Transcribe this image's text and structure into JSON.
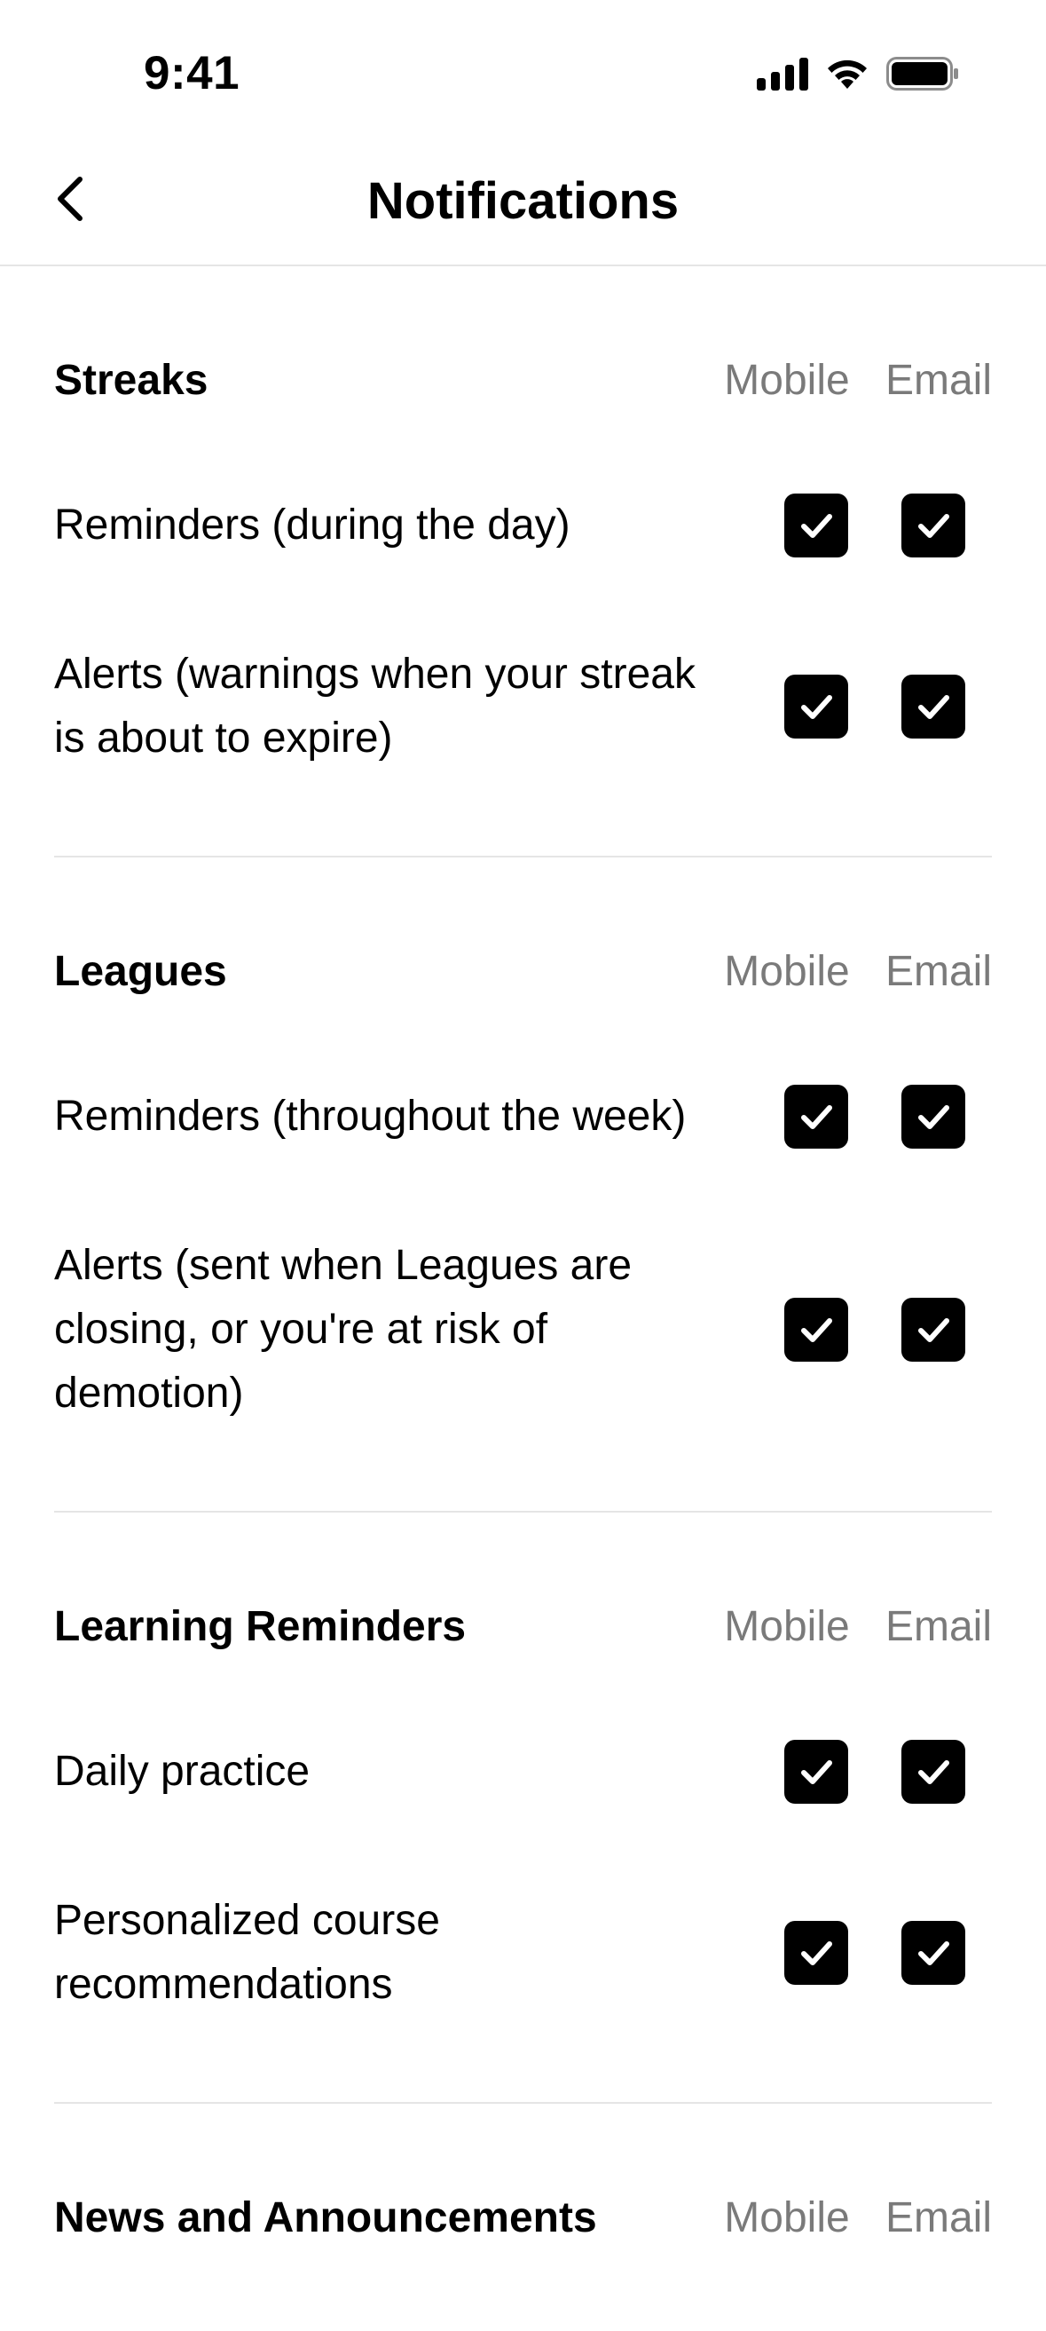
{
  "status_bar": {
    "time": "9:41",
    "icons": [
      "cellular-signal-icon",
      "wifi-icon",
      "battery-icon"
    ]
  },
  "nav": {
    "back_icon": "chevron-left-icon",
    "title": "Notifications"
  },
  "columns": {
    "mobile": "Mobile",
    "email": "Email"
  },
  "sections": [
    {
      "title": "Streaks",
      "rows": [
        {
          "label": "Reminders (during the day)",
          "mobile": true,
          "email": true
        },
        {
          "label": "Alerts (warnings when your streak is about to expire)",
          "mobile": true,
          "email": true
        }
      ]
    },
    {
      "title": "Leagues",
      "rows": [
        {
          "label": "Reminders (throughout the week)",
          "mobile": true,
          "email": true
        },
        {
          "label": "Alerts (sent when Leagues are closing, or you're at risk of demotion)",
          "mobile": true,
          "email": true
        }
      ]
    },
    {
      "title": "Learning Reminders",
      "rows": [
        {
          "label": "Daily practice",
          "mobile": true,
          "email": true
        },
        {
          "label": "Personalized course recommendations",
          "mobile": true,
          "email": true
        }
      ]
    },
    {
      "title": "News and Announcements",
      "rows": []
    }
  ],
  "colors": {
    "text": "#000000",
    "muted": "#7a7a7a",
    "divider": "#e5e5e5",
    "checkbox_fill": "#000000",
    "checkmark": "#ffffff"
  }
}
